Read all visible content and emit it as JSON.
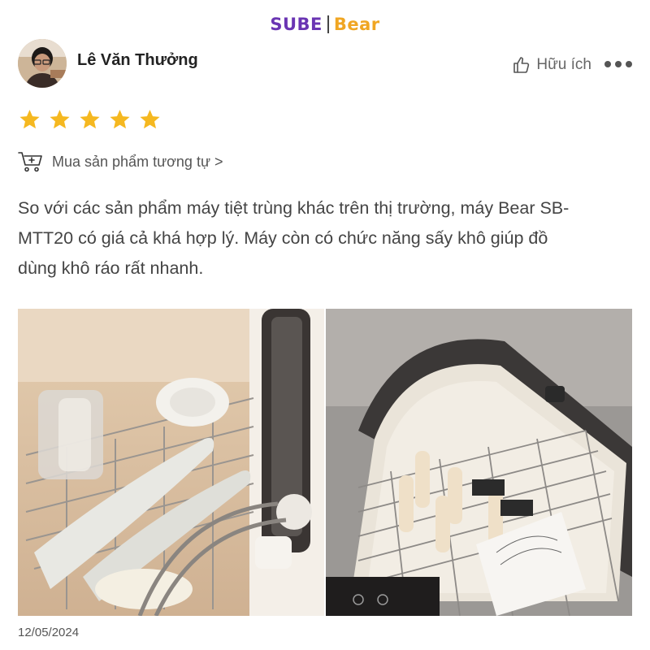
{
  "brand": {
    "left": "SUBE",
    "right": "Bear"
  },
  "review": {
    "author": "Lê Văn Thưởng",
    "helpful_label": "Hữu ích",
    "rating": 5,
    "rating_max": 5,
    "buy_similar_label": "Mua sản phẩm tương tự >",
    "text": "So với các sản phẩm máy tiệt trùng khác trên thị trường, máy Bear SB-MTT20 có giá cả khá hợp lý. Máy còn có chức năng sấy khô giúp đồ dùng khô ráo rất nhanh.",
    "date": "12/05/2024"
  },
  "icons": {
    "like": "thumbs-up-icon",
    "more": "more-dots-icon",
    "cart": "cart-add-icon",
    "star": "star-icon"
  },
  "colors": {
    "star": "#f5b820",
    "brand_purple": "#6a35b3",
    "brand_orange": "#f0a623"
  }
}
